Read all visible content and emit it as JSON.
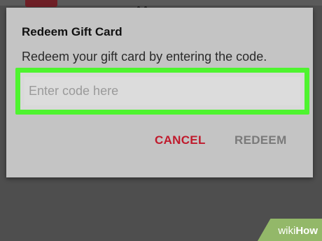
{
  "dialog": {
    "title": "Redeem Gift Card",
    "message": "Redeem your gift card by entering the code.",
    "code_field": {
      "value": "",
      "placeholder": "Enter code here"
    },
    "buttons": {
      "cancel_label": "CANCEL",
      "redeem_label": "REDEEM"
    }
  },
  "watermark": {
    "prefix": "wiki",
    "suffix": "How"
  },
  "colors": {
    "highlight_border": "#4ef42f",
    "cancel_text": "#c01a2c",
    "redeem_text_disabled": "#7a7a7a",
    "dialog_background": "#c4c4c4",
    "scrim": "#4e4e4e",
    "watermark_badge": "#93b869"
  }
}
